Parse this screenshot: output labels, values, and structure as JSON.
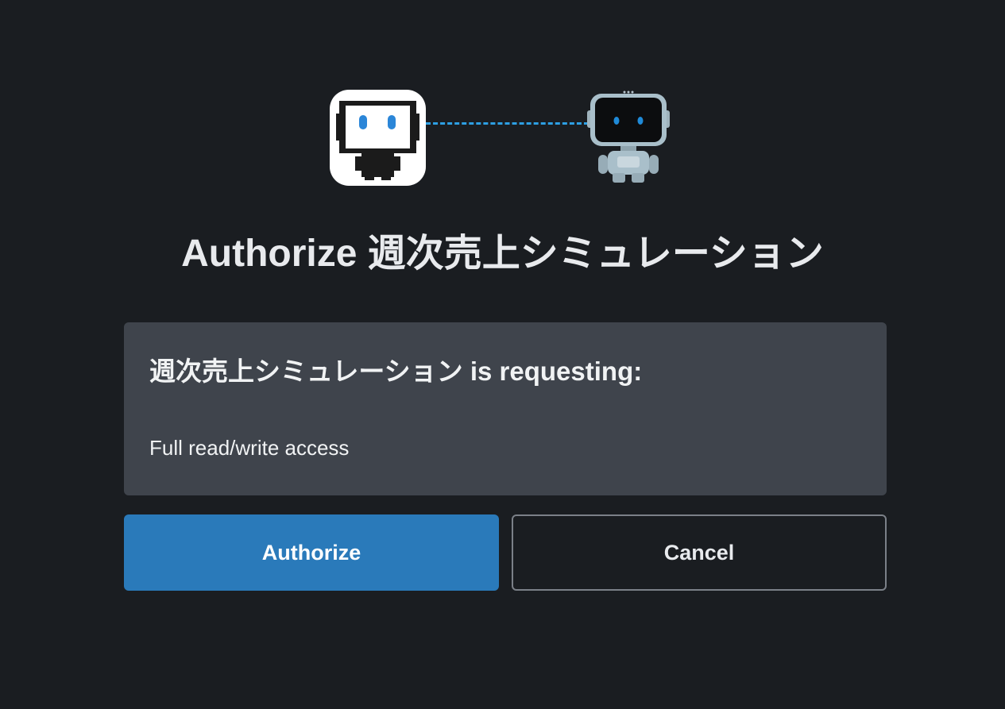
{
  "logos": {
    "app_logo": "pixel-robot-app-icon",
    "platform_logo": "robot-mascot-icon",
    "connector": "dashed-link-line"
  },
  "title": {
    "prefix": "Authorize",
    "app_name": "週次売上シミュレーション",
    "text": "Authorize 週次売上シミュレーション"
  },
  "request": {
    "heading": "週次売上シミュレーション is requesting:",
    "scopes": [
      "Full read/write access"
    ]
  },
  "buttons": {
    "authorize_label": "Authorize",
    "cancel_label": "Cancel"
  },
  "colors": {
    "background": "#1a1d21",
    "panel": "#3f444c",
    "accent": "#2a7aba",
    "connector": "#2d9fe3"
  }
}
